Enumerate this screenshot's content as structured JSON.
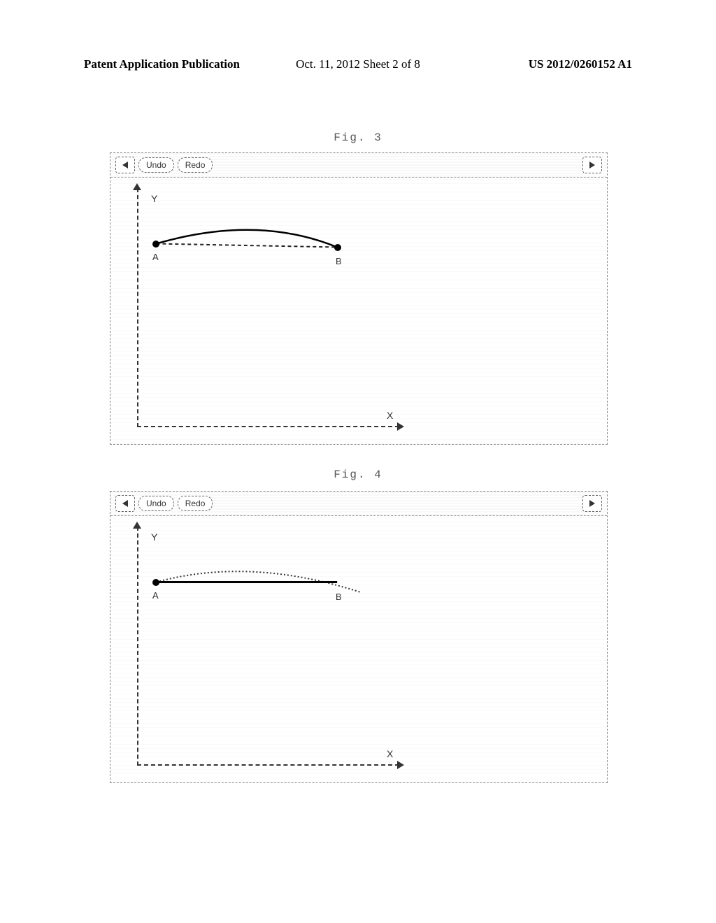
{
  "header": {
    "left": "Patent Application Publication",
    "center": "Oct. 11, 2012  Sheet 2 of 8",
    "right": "US 2012/0260152 A1"
  },
  "figures": {
    "fig3": {
      "label": "Fig. 3",
      "toolbar": {
        "undo": "Undo",
        "redo": "Redo"
      },
      "axes": {
        "y_label": "Y",
        "x_label": "X"
      },
      "points": {
        "A": "A",
        "B": "B"
      }
    },
    "fig4": {
      "label": "Fig. 4",
      "toolbar": {
        "undo": "Undo",
        "redo": "Redo"
      },
      "axes": {
        "y_label": "Y",
        "x_label": "X"
      },
      "points": {
        "A": "A",
        "B": "B"
      }
    }
  },
  "chart_data": [
    {
      "type": "line",
      "title": "Fig. 3",
      "xlabel": "X",
      "ylabel": "Y",
      "series": [
        {
          "name": "straight-line-AB",
          "style": "dashed",
          "points": [
            {
              "label": "A",
              "x": 65,
              "y": 95
            },
            {
              "label": "B",
              "x": 325,
              "y": 100
            }
          ]
        },
        {
          "name": "curve-AB-above",
          "style": "solid",
          "control": {
            "x": 210,
            "y": 63
          },
          "points": [
            {
              "label": "A",
              "x": 65,
              "y": 95
            },
            {
              "label": "B",
              "x": 325,
              "y": 100
            }
          ]
        }
      ]
    },
    {
      "type": "line",
      "title": "Fig. 4",
      "xlabel": "X",
      "ylabel": "Y",
      "series": [
        {
          "name": "straight-line-AB",
          "style": "solid",
          "points": [
            {
              "label": "A",
              "x": 65,
              "y": 95
            },
            {
              "label": "B",
              "x": 325,
              "y": 95
            }
          ]
        },
        {
          "name": "curve-AB-overshoot",
          "style": "dotted",
          "control": {
            "x": 200,
            "y": 68
          },
          "points": [
            {
              "label": "A",
              "x": 65,
              "y": 95
            },
            {
              "label": "B-overshoot",
              "x": 360,
              "y": 110
            }
          ]
        }
      ]
    }
  ]
}
